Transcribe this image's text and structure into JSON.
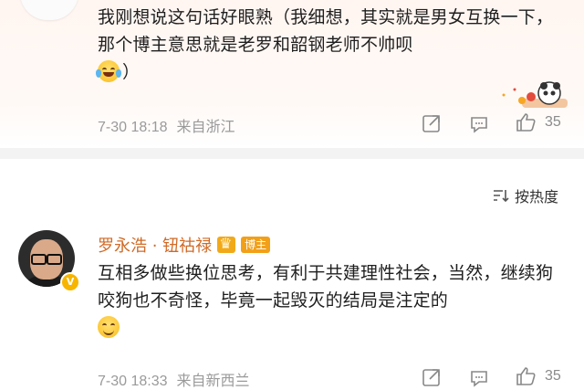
{
  "comment1": {
    "text": "我刚想说这句话好眼熟（我细想，其实就是男女互换一下，那个博主意思就是老罗和韶钢老师不帅呗",
    "text_end": "）",
    "emoji": "laughing-tears-emoji",
    "time": "7-30 18:18",
    "location": "来自浙江",
    "likes": "35"
  },
  "sort": {
    "label": "按热度"
  },
  "comment2": {
    "username": "罗永浩 · 钮祜禄",
    "tag": "博主",
    "text": "互相多做些换位思考，有利于共建理性社会，当然，继续狗咬狗也不奇怪，毕竟一起毁灭的结局是注定的",
    "emoji": "smile-emoji",
    "time": "7-30 18:33",
    "location": "来自新西兰",
    "likes": "35"
  },
  "colors": {
    "username": "#d06a26",
    "meta": "#9a9a9a",
    "tag": "#f2a018"
  }
}
